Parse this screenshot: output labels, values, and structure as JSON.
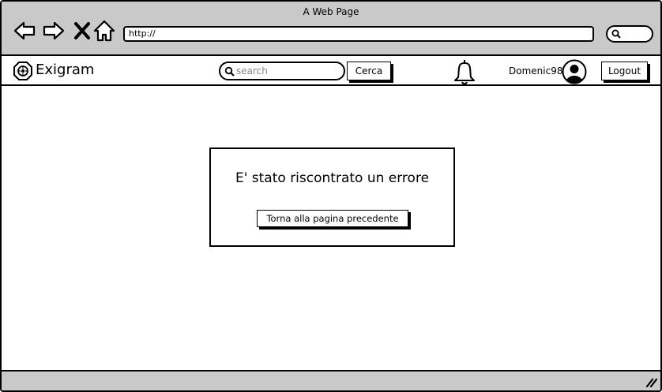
{
  "window": {
    "title": "A Web Page"
  },
  "browser": {
    "url": "http://",
    "icons": {
      "back": "arrow-left-icon",
      "forward": "arrow-right-icon",
      "stop": "close-icon",
      "home": "home-icon",
      "search": "search-icon"
    }
  },
  "header": {
    "brand": "Exigram",
    "logo_icon": "logo-icon",
    "search": {
      "placeholder": "search",
      "value": ""
    },
    "search_button_label": "Cerca",
    "notification_icon": "bell-icon",
    "username": "Domenic98",
    "avatar_icon": "user-avatar-icon",
    "logout_label": "Logout"
  },
  "error": {
    "message": "E' stato riscontrato un errore",
    "back_button_label": "Torna alla pagina precedente"
  },
  "colors": {
    "chrome_gray": "#c9c9c9",
    "border": "#000000",
    "background": "#ffffff"
  }
}
